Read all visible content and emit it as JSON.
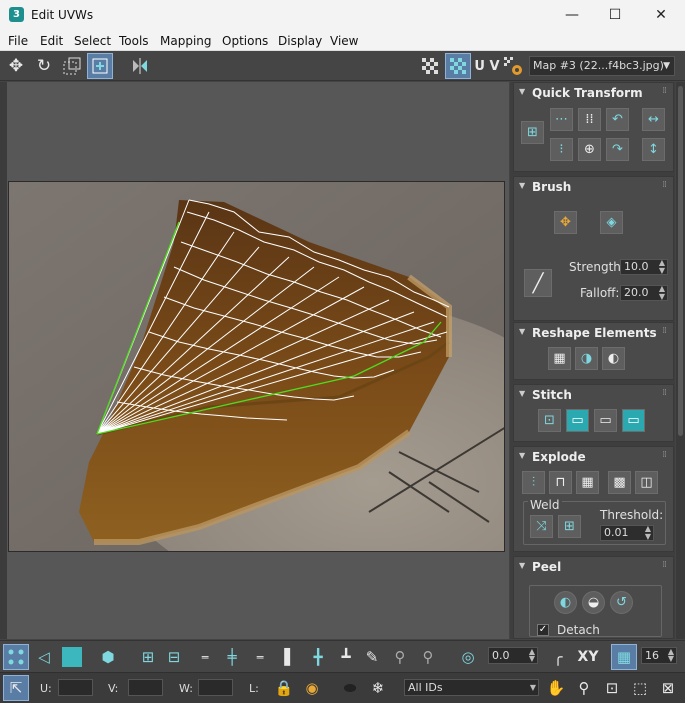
{
  "window": {
    "title": "Edit UVWs",
    "app_icon": "3",
    "minimize": "—",
    "maximize": "☐",
    "close": "✕"
  },
  "menu": [
    "File",
    "Edit",
    "Select",
    "Tools",
    "Mapping",
    "Options",
    "Display",
    "View"
  ],
  "toolbar": {
    "uv_label": "U V",
    "map_select": "Map #3 (22...f4bc3.jpg)",
    "icons": [
      "move-icon",
      "rotate-icon",
      "scale-icon",
      "freeform-icon",
      "mirror-icon",
      "checker-icon",
      "checker-active-icon",
      "settings-icon"
    ]
  },
  "quick_transform": {
    "title": "Quick Transform"
  },
  "brush": {
    "title": "Brush",
    "strength_label": "Strength:",
    "strength_value": "10.0",
    "falloff_label": "Falloff:",
    "falloff_value": "20.0"
  },
  "reshape": {
    "title": "Reshape Elements"
  },
  "stitch": {
    "title": "Stitch"
  },
  "explode": {
    "title": "Explode",
    "weld_label": "Weld",
    "threshold_label": "Threshold:",
    "threshold_value": "0.01"
  },
  "peel": {
    "title": "Peel",
    "detach_label": "Detach",
    "detach_checked": true
  },
  "bottom1": {
    "angle_value": "0.0",
    "xy_label": "XY",
    "grid_value": "16"
  },
  "bottom2": {
    "u_label": "U:",
    "v_label": "V:",
    "w_label": "W:",
    "l_label": "L:",
    "ids_select": "All IDs"
  },
  "colors": {
    "accent": "#5a7da6",
    "mesh": "#ffffff",
    "seam": "#4fdc1e",
    "panel": "#4a4a4a",
    "icon_teal": "#7fd8e0"
  }
}
